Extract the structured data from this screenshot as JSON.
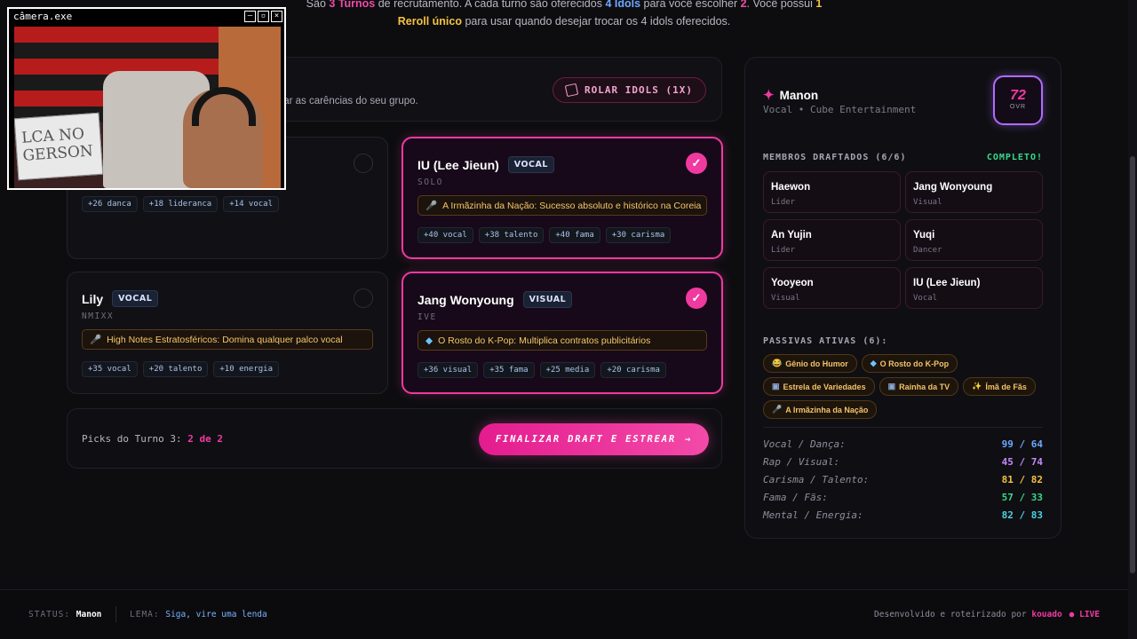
{
  "intro": {
    "line1_a": "São ",
    "turns": "3 Turnos",
    "line1_b": " de recrutamento. A cada turno são oferecidos ",
    "idols": "4 Idols",
    "line1_c": " para você escolher ",
    "choose": "2",
    "line1_d": ". Você possui ",
    "reroll_count": "1",
    "reroll_label": "Reroll único",
    "line2": " para usar quando desejar trocar os 4 idols oferecidos."
  },
  "header": {
    "desc": "tar as carências do seu grupo.",
    "reroll_button": "ROLAR IDOLS (1X)"
  },
  "cards": [
    {
      "name": "",
      "role": "",
      "group": "",
      "passive": "",
      "tags": [
        "+26 danca",
        "+18 lideranca",
        "+14 vocal"
      ],
      "selected": false
    },
    {
      "name": "IU (Lee Jieun)",
      "role": "VOCAL",
      "group": "SOLO",
      "passive": "A Irmãzinha da Nação: Sucesso absoluto e histórico na Coreia",
      "passive_icon": "microphone-icon",
      "tags": [
        "+40 vocal",
        "+38 talento",
        "+40 fama",
        "+30 carisma"
      ],
      "selected": true
    },
    {
      "name": "Lily",
      "role": "VOCAL",
      "group": "NMIXX",
      "passive": "High Notes Estratosféricos: Domina qualquer palco vocal",
      "passive_icon": "microphone-icon",
      "tags": [
        "+35 vocal",
        "+20 talento",
        "+10 energia"
      ],
      "selected": false
    },
    {
      "name": "Jang Wonyoung",
      "role": "VISUAL",
      "group": "IVE",
      "passive": "O Rosto do K-Pop: Multiplica contratos publicitários",
      "passive_icon": "diamond-icon",
      "tags": [
        "+36 visual",
        "+35 fama",
        "+25 media",
        "+20 carisma"
      ],
      "selected": true
    }
  ],
  "picks": {
    "label": "Picks do Turno 3: ",
    "value": "2 de 2",
    "finalize_button": "FINALIZAR DRAFT E ESTREAR"
  },
  "profile": {
    "name": "Manon",
    "subtitle": "Vocal • Cube Entertainment",
    "ovr": "72",
    "ovr_label": "OVR"
  },
  "members": {
    "title": "MEMBROS DRAFTADOS (6/6)",
    "status": "COMPLETO!",
    "list": [
      {
        "name": "Haewon",
        "role": "Líder"
      },
      {
        "name": "Jang Wonyoung",
        "role": "Visual"
      },
      {
        "name": "An Yujin",
        "role": "Líder"
      },
      {
        "name": "Yuqi",
        "role": "Dancer"
      },
      {
        "name": "Yooyeon",
        "role": "Visual"
      },
      {
        "name": "IU (Lee Jieun)",
        "role": "Vocal"
      }
    ]
  },
  "passives": {
    "title": "PASSIVAS ATIVAS (6):",
    "list": [
      {
        "label": "Gênio do Humor",
        "icon": "laughing-face-icon"
      },
      {
        "label": "O Rosto do K-Pop",
        "icon": "diamond-icon"
      },
      {
        "label": "Estrela de Variedades",
        "icon": "tv-icon"
      },
      {
        "label": "Rainha da TV",
        "icon": "tv-icon"
      },
      {
        "label": "Ímã de Fãs",
        "icon": "sparkle-icon"
      },
      {
        "label": "A Irmãzinha da Nação",
        "icon": "microphone-icon"
      }
    ]
  },
  "stats": [
    {
      "label": "Vocal / Dança:",
      "value": "99 / 64",
      "color": "#6fa6ff"
    },
    {
      "label": "Rap / Visual:",
      "value": "45 / 74",
      "color": "#c58bff"
    },
    {
      "label": "Carisma / Talento:",
      "value": "81 / 82",
      "color": "#f5c342"
    },
    {
      "label": "Fama / Fãs:",
      "value": "57 / 33",
      "color": "#38d98a"
    },
    {
      "label": "Mental / Energia:",
      "value": "82 / 83",
      "color": "#4fd1e0"
    }
  ],
  "footer": {
    "status_label": "STATUS:",
    "status_value": "Manon",
    "lema_label": "LEMA:",
    "lema_value": "Siga, vire uma lenda",
    "dev_text": "Desenvolvido e roteirizado por ",
    "dev_name": "kouado",
    "live": "● LIVE"
  },
  "camera": {
    "title": "câmera.exe",
    "sign_text": "LCA NO GERSON"
  },
  "colors": {
    "accent": "#f03aa0",
    "background": "#0d0d10"
  }
}
